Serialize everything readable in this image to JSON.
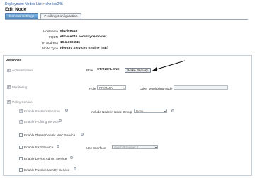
{
  "breadcrumb": {
    "parent": "Deployment Nodes List",
    "separator": ">",
    "current": "ehz-ise245"
  },
  "page_title": "Edit Node",
  "tabs": [
    {
      "label": "General Settings",
      "active": true
    },
    {
      "label": "Profiling Configuration",
      "active": false
    }
  ],
  "node_info": {
    "hostname_label": "Hostname",
    "hostname_value": "ehz-ise245",
    "fqdn_label": "FQDN",
    "fqdn_value": "ehz-ise245.securitydemo.net",
    "ip_label": "IP Address",
    "ip_value": "10.1.100.245",
    "type_label": "Node Type",
    "type_value": "Identity Services Engine (ISE)"
  },
  "personas": {
    "section_title": "Personas",
    "administration": {
      "label": "Administration",
      "checked": true,
      "role_label": "Role",
      "role_value": "STANDALONE",
      "button_label": "Make Primary"
    },
    "monitoring": {
      "label": "Monitoring",
      "checked": true,
      "role_label": "Role",
      "role_value": "PRIMARY",
      "other_label": "Other Monitoring Node",
      "other_value": ""
    },
    "policy_service": {
      "label": "Policy Service",
      "checked": true
    }
  },
  "services": {
    "session": {
      "label": "Enable Session Services",
      "checked": true,
      "group_label": "Include Node in Node Group",
      "group_value": "None"
    },
    "profiling": {
      "label": "Enable Profiling Service",
      "checked": true
    },
    "threat": {
      "label": "Enable Threat Centric NAC Service",
      "checked": false
    },
    "sxp": {
      "label": "Enable SXP Service",
      "checked": false,
      "interface_label": "Use Interface",
      "interface_value": "GigabitEthernet 0"
    },
    "device_admin": {
      "label": "Enable Device Admin Service",
      "checked": false
    },
    "passive_identity": {
      "label": "Enable Passive Identity Service",
      "checked": false
    }
  },
  "icons": {
    "info": "info-icon",
    "checkbox_check": "checkmark-icon",
    "dropdown": "chevron-down-icon"
  },
  "colors": {
    "link": "#2a5db0",
    "tab_active": "#4d87c0",
    "annotation_arrow": "#111111"
  }
}
